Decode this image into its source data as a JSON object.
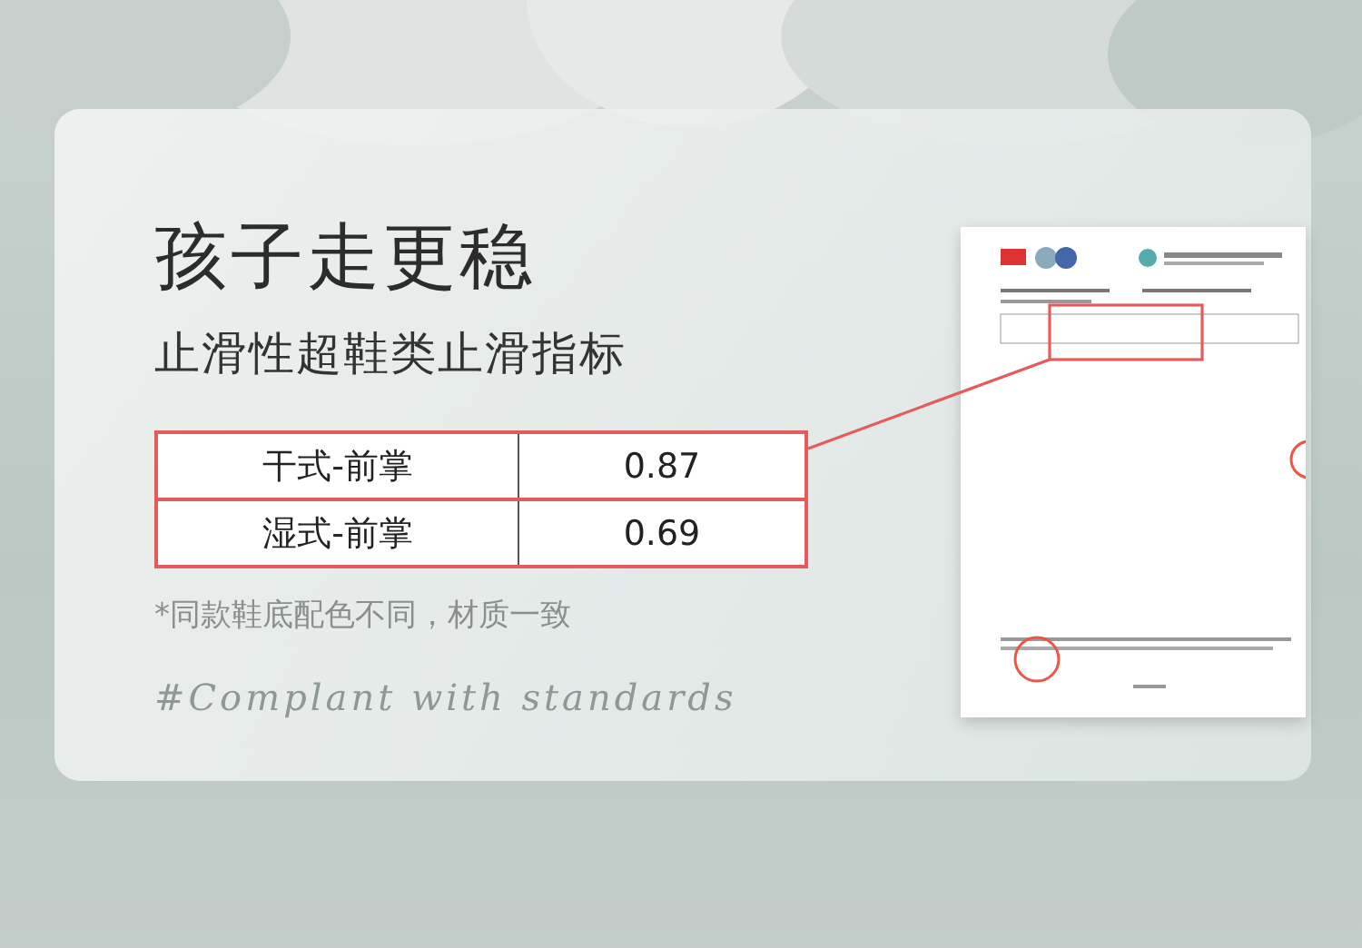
{
  "title": "孩子走更稳",
  "subtitle": "止滑性超鞋类止滑指标",
  "table": {
    "rows": [
      {
        "label": "干式-前掌",
        "value": "0.87"
      },
      {
        "label": "湿式-前掌",
        "value": "0.69"
      }
    ]
  },
  "note": "*同款鞋底配色不同，材质一致",
  "script_text": "#Complant with standards"
}
